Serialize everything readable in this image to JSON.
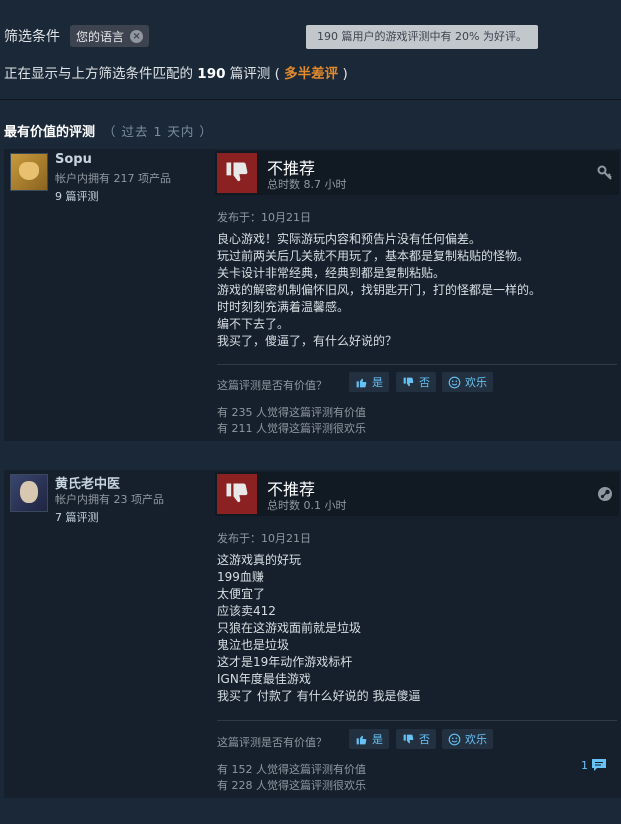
{
  "filter": {
    "label": "筛选条件",
    "chip": "您的语言",
    "tooltip": "190 篇用户的游戏评测中有 20% 为好评。"
  },
  "summary": {
    "prefix": "正在显示与上方筛选条件匹配的",
    "count": "190",
    "middle": "篇评测 (",
    "rating": "多半差评",
    "suffix": ")"
  },
  "section": {
    "title": "最有价值的评测",
    "period": "（ 过去 1 天内 ）"
  },
  "reviews": [
    {
      "author": "Sopu",
      "owns": "帐户内拥有 217 项产品",
      "review_count": "9 篇评测",
      "verdict": "不推荐",
      "hours": "总时数 8.7 小时",
      "posted": "发布于：10月21日",
      "text": "良心游戏！实际游玩内容和预告片没有任何偏差。\n玩过前两关后几关就不用玩了，基本都是复制粘贴的怪物。\n关卡设计非常经典，经典到都是复制粘贴。\n游戏的解密机制偏怀旧风，找钥匙开门，打的怪都是一样的。\n时时刻刻充满着温馨感。\n编不下去了。\n我买了，傻逼了，有什么好说的？",
      "helpful_question": "这篇评测是否有价值？",
      "yes": "是",
      "no": "否",
      "funny": "欢乐",
      "helpful_stat": "有 235 人觉得这篇评测有价值",
      "funny_stat": "有 211 人觉得这篇评测很欢乐",
      "corner_icon": "key-icon"
    },
    {
      "author": "黄氏老中医",
      "owns": "帐户内拥有 23 项产品",
      "review_count": "7 篇评测",
      "verdict": "不推荐",
      "hours": "总时数 0.1 小时",
      "posted": "发布于：10月21日",
      "text": "这游戏真的好玩\n199血赚\n太便宜了\n应该卖412\n只狼在这游戏面前就是垃圾\n鬼泣也是垃圾\n这才是19年动作游戏标杆\nIGN年度最佳游戏\n我买了 付款了 有什么好说的 我是傻逼",
      "helpful_question": "这篇评测是否有价值？",
      "yes": "是",
      "no": "否",
      "funny": "欢乐",
      "helpful_stat": "有 152 人觉得这篇评测有价值",
      "funny_stat": "有 228 人觉得这篇评测很欢乐",
      "comment_count": "1",
      "corner_icon": "steam-icon"
    }
  ]
}
